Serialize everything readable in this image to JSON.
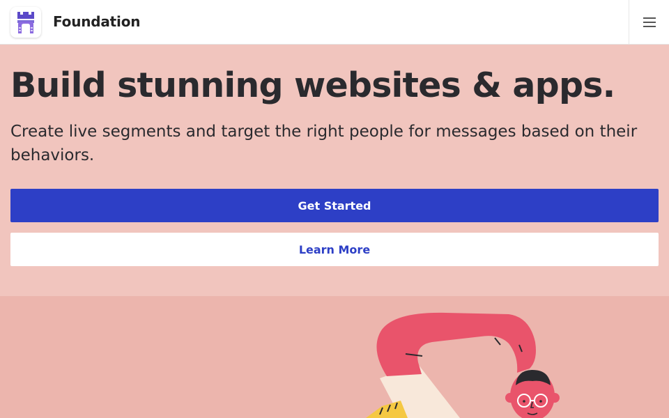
{
  "header": {
    "brand_name": "Foundation",
    "logo_icon": "castle-gate-icon",
    "menu_icon": "hamburger-menu-icon"
  },
  "hero": {
    "headline": "Build stunning websites & apps.",
    "subtitle": "Create live segments and target the right people for messages based on their behaviors.",
    "primary_button": "Get Started",
    "secondary_button": "Learn More"
  },
  "illustration": {
    "name": "person-stretching-illustration"
  },
  "colors": {
    "accent": "#2d3fc6",
    "hero_background": "#f1c5be",
    "illustration_background": "#ecb5ad",
    "logo_purple": "#5b49c8",
    "figure_pink": "#e9546b"
  }
}
